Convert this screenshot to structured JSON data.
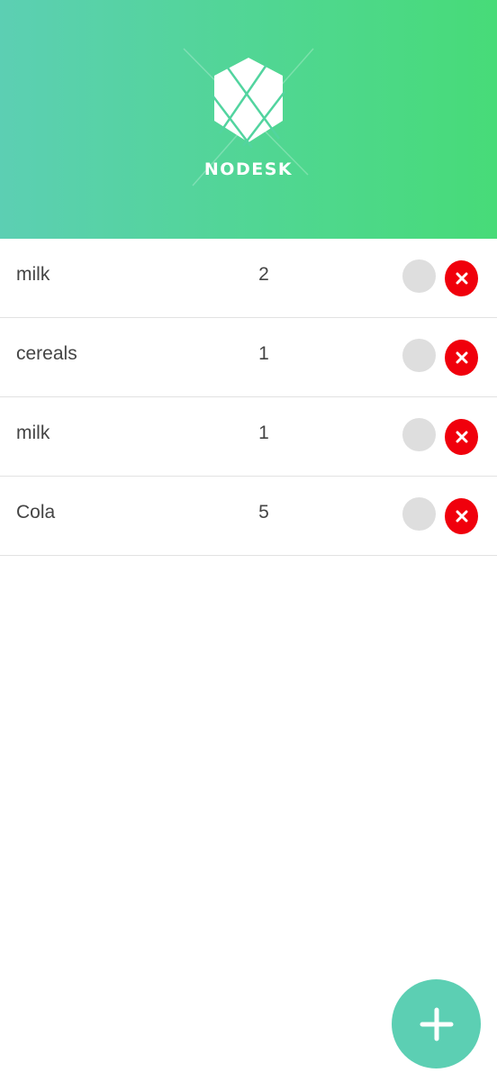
{
  "header": {
    "logo_text": "NODESK",
    "gradient_start": "#5ccfb3",
    "gradient_end": "#47db78"
  },
  "items": [
    {
      "name": "milk",
      "quantity": "2"
    },
    {
      "name": "cereals",
      "quantity": "1"
    },
    {
      "name": "milk",
      "quantity": "1"
    },
    {
      "name": "Cola",
      "quantity": "5"
    }
  ],
  "controls": {
    "toggle_icon": "circle-toggle-icon",
    "delete_icon": "close-icon",
    "delete_color": "#f0000c",
    "add_icon": "plus-icon",
    "add_color": "#5ccfb3"
  }
}
